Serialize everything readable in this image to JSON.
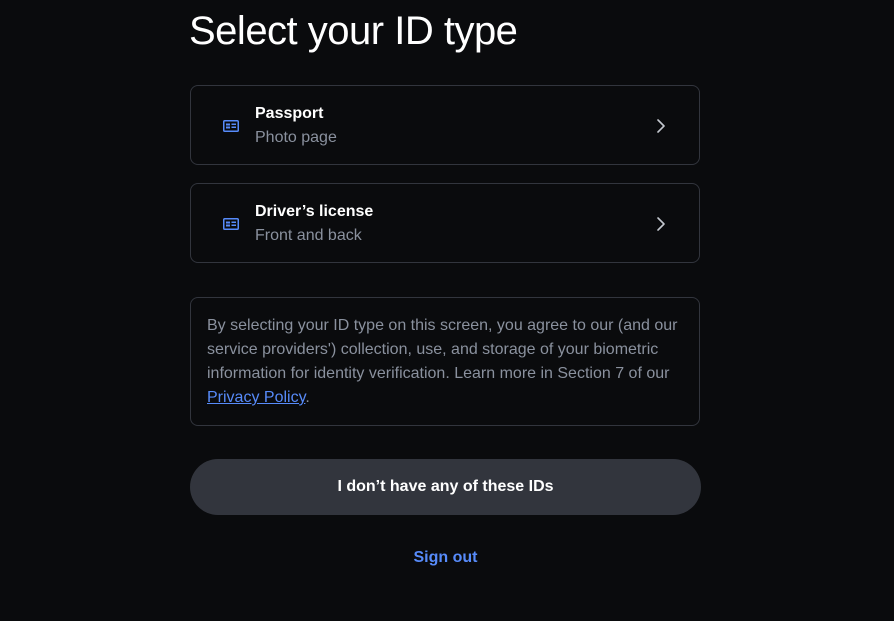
{
  "page": {
    "title": "Select your ID type"
  },
  "options": [
    {
      "label": "Passport",
      "sublabel": "Photo page",
      "icon": "id-card-icon"
    },
    {
      "label": "Driver’s license",
      "sublabel": "Front and back",
      "icon": "id-card-icon"
    }
  ],
  "consent": {
    "text_before": "By selecting your ID type on this screen, you agree to our (and our service providers') collection, use, and storage of your biometric information for identity verification. Learn more in Section 7 of our ",
    "link_text": "Privacy Policy",
    "text_after": "."
  },
  "actions": {
    "no_id_label": "I don’t have any of these IDs",
    "sign_out_label": "Sign out"
  },
  "colors": {
    "background": "#0a0b0d",
    "border": "#32353d",
    "muted_text": "#8a919e",
    "accent": "#578bfa",
    "button_bg": "#32353d"
  }
}
